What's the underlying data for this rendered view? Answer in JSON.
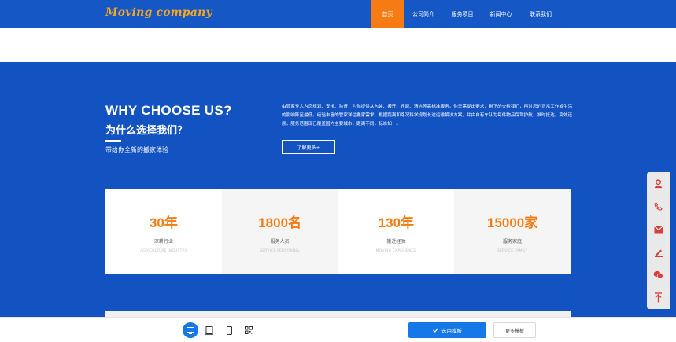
{
  "header": {
    "logo": "Moving company",
    "nav": [
      "首页",
      "公司简介",
      "服务项目",
      "新闻中心",
      "联系我们"
    ],
    "active_index": 0
  },
  "why": {
    "title": "WHY CHOOSE US?",
    "title_cn": "为什么选择我们？",
    "subtitle": "带给你全新的搬家体验",
    "intro": "由管家专人为您规划、安排、监督，为你提供从包装、搬迁、还原、清洁等高标准服务。你只需提出要求，剩下的交给我们，再对您的正常工作或生活的影响降至最低。经验丰富的管家详估搬家需求，根据距离和路况科学规划长途运输解决方案，并由自有车队为每件物品保驾护航，准时抵达。高效还原，服务范围现已覆盖国内主要城市，距离不同，标准如一。",
    "more_button": "了解更多+"
  },
  "stats": [
    {
      "value": "30年",
      "label": "深耕行业",
      "label_en": "AGRICULTURE INDUSTRY"
    },
    {
      "value": "1800名",
      "label": "服务人员",
      "label_en": "SERVICE PERSONNEL"
    },
    {
      "value": "130年",
      "label": "搬迁经验",
      "label_en": "MOVING EXPERIENCE"
    },
    {
      "value": "15000家",
      "label": "服务家庭",
      "label_en": "SERVICE FAMILY"
    }
  ],
  "side_panel": {
    "icons": [
      "support-avatar-icon",
      "phone-icon",
      "mail-icon",
      "edit-icon",
      "wechat-icon",
      "back-to-top-icon"
    ],
    "icon_color": "#d6403a"
  },
  "toolbar": {
    "devices": [
      "desktop-icon",
      "tablet-icon",
      "mobile-icon",
      "qrcode-icon"
    ],
    "use_template": "选用模板",
    "more_templates": "更多模板"
  },
  "colors": {
    "brand_blue": "#1352c1",
    "accent_orange": "#f57b12",
    "logo_orange": "#f5a623",
    "button_blue": "#1677e6"
  }
}
